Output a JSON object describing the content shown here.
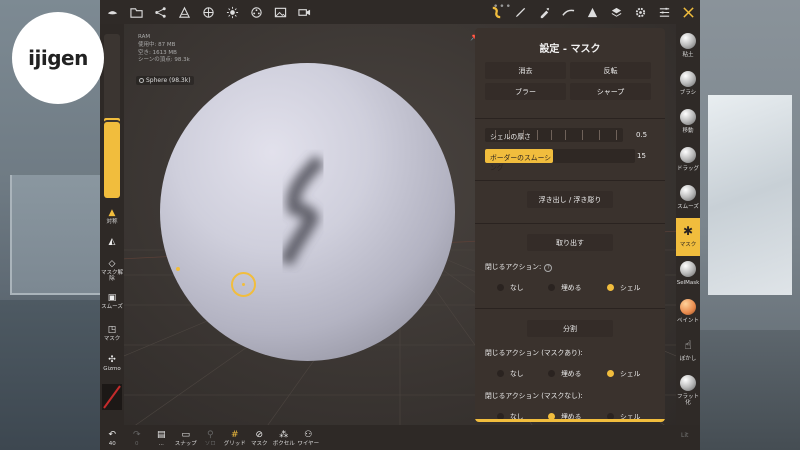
{
  "logo": {
    "text": "ijigen"
  },
  "info": {
    "lines": [
      "RAM",
      "使用中: 87 MB",
      "空き: 1613 MB",
      "シーンの頂点: 98.3k"
    ],
    "object": "Sphere (98.3k)"
  },
  "topbar": {
    "left_icons": [
      "menu-icon",
      "folder-icon",
      "share-icon",
      "layers-icon",
      "globe-icon",
      "sun-icon",
      "film-reel-icon",
      "image-icon",
      "camera-icon"
    ],
    "right_icons": [
      "mask-tool-icon",
      "pen-icon",
      "dropper-icon",
      "brush-stroke-icon",
      "triangle-icon",
      "stack-icon",
      "gear-icon",
      "sliders-icon",
      "tools-icon"
    ]
  },
  "left_strip": {
    "slider_top_fill": 0.05,
    "slider_bottom_fill": 0.98,
    "items": [
      {
        "icon": "symmetry-icon",
        "label": "対称"
      },
      {
        "icon": "brush-icon",
        "label": ""
      },
      {
        "icon": "eraser-icon",
        "label": "マスク解除"
      },
      {
        "icon": "smooth-icon",
        "label": "スムーズ"
      },
      {
        "icon": "mask-icon",
        "label": "マスク"
      },
      {
        "icon": "gizmo-icon",
        "label": "Gizmo"
      }
    ]
  },
  "bottombar": {
    "items": [
      {
        "label": "40",
        "icon": "undo-icon"
      },
      {
        "label": "0",
        "icon": "redo-icon",
        "dim": true
      },
      {
        "label": "...",
        "icon": "book-icon"
      },
      {
        "label": "スナップ",
        "icon": "snap-icon"
      },
      {
        "label": "ソロ",
        "icon": "solo-icon",
        "dim": true
      },
      {
        "label": "グリッド",
        "icon": "grid-icon"
      },
      {
        "label": "マスク",
        "icon": "mask-eye-icon"
      },
      {
        "label": "ボクセル",
        "icon": "voxel-icon"
      },
      {
        "label": "ワイヤー",
        "icon": "wire-icon"
      }
    ]
  },
  "panel": {
    "title": "設定 - マスク",
    "buttons": {
      "clear": "消去",
      "invert": "反転",
      "blur": "ブラー",
      "sharpen": "シャープ"
    },
    "shell_thickness": {
      "label": "シェルの厚さ",
      "value": "0.5",
      "fraction": 0
    },
    "border_smoothing": {
      "label": "ボーダーのスムーシング",
      "value": "15",
      "fraction": 0.45
    },
    "emboss_button": "浮き出し / 浮き彫り",
    "extract_button": "取り出す",
    "close_action_label": "閉じるアクション:",
    "help": "?",
    "options": {
      "none": "なし",
      "fill": "埋める",
      "shell": "シェル"
    },
    "split_button": "分割",
    "close_action_masked": "閉じるアクション (マスクあり):",
    "close_action_unmasked": "閉じるアクション (マスクなし):"
  },
  "right_strip": {
    "items": [
      {
        "label": "粘土"
      },
      {
        "label": "ブラシ"
      },
      {
        "label": "移動"
      },
      {
        "label": "ドラッグ"
      },
      {
        "label": "スムーズ"
      },
      {
        "label": "マスク",
        "active": true
      },
      {
        "label": "SelMask"
      },
      {
        "label": "ペイント"
      },
      {
        "label": "ぼかし"
      },
      {
        "label": "フラット化"
      }
    ],
    "footer": "Lit"
  },
  "colors": {
    "accent": "#f1bd3d",
    "panel": "#3a322d",
    "toolbar": "#2f2a27"
  }
}
